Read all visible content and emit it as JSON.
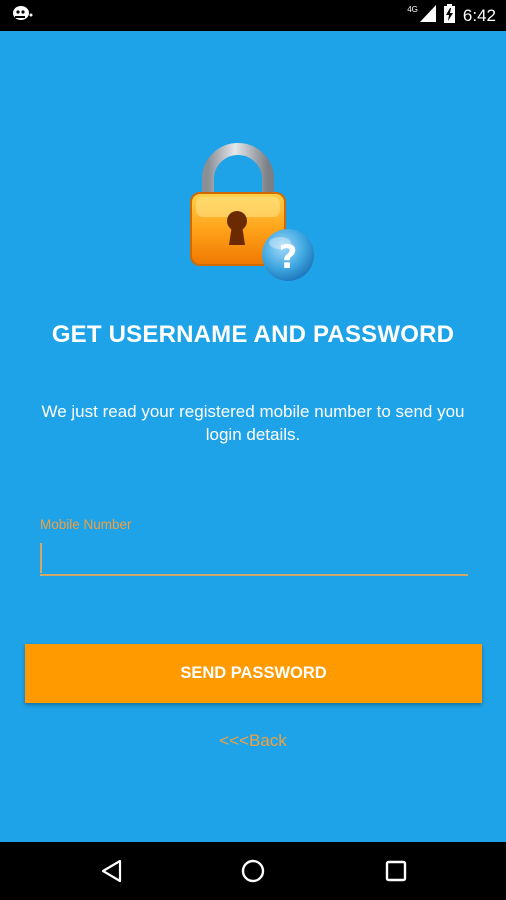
{
  "status_bar": {
    "time": "6:42",
    "network": "4G",
    "icons": [
      "app-notification-icon",
      "signal-icon",
      "battery-icon"
    ]
  },
  "content": {
    "title": "GET USERNAME AND PASSWORD",
    "description": "We just read your registered mobile number to send you login details.",
    "mobile_label": "Mobile Number",
    "mobile_value": "",
    "send_button_label": "SEND PASSWORD",
    "back_link_label": "<<<Back",
    "icon": "lock-question-icon"
  },
  "nav_bar": {
    "icons": [
      "back-icon",
      "home-icon",
      "recents-icon"
    ]
  },
  "colors": {
    "background": "#1ea3e8",
    "button": "#ff9a00",
    "accent_text": "#f0a040",
    "bars": "#000000"
  }
}
